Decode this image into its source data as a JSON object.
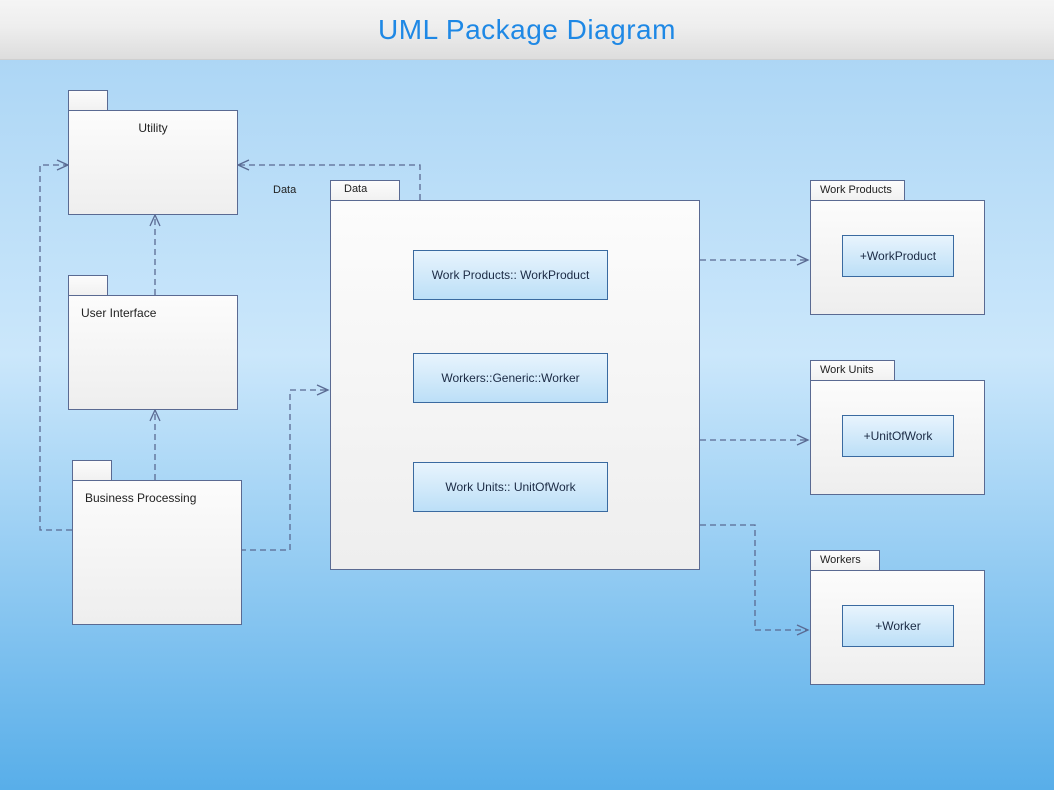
{
  "title": "UML Package Diagram",
  "packages": {
    "utility": {
      "label": "Utility"
    },
    "userInterface": {
      "label": "User Interface"
    },
    "businessProcessing": {
      "label": "Business Processing"
    },
    "data": {
      "label": "Data"
    },
    "workProducts": {
      "label": "Work Products",
      "inner": "+WorkProduct"
    },
    "workUnits": {
      "label": "Work Units",
      "inner": "+UnitOfWork"
    },
    "workers": {
      "label": "Workers",
      "inner": "+Worker"
    }
  },
  "classes": {
    "workProduct": {
      "label": "Work Products:: WorkProduct"
    },
    "worker": {
      "label": "Workers::Generic::Worker"
    },
    "unitOfWork": {
      "label": "Work Units:: UnitOfWork"
    }
  },
  "dependencies": [
    {
      "from": "Business Processing",
      "to": "Utility"
    },
    {
      "from": "User Interface",
      "to": "Utility"
    },
    {
      "from": "Business Processing",
      "to": "User Interface"
    },
    {
      "from": "Data",
      "to": "Utility"
    },
    {
      "from": "Business Processing",
      "to": "Data"
    },
    {
      "from": "Data",
      "to": "Work Products"
    },
    {
      "from": "Data",
      "to": "Work Units"
    },
    {
      "from": "Data",
      "to": "Workers"
    }
  ],
  "associations": [
    {
      "between": [
        "Work Products:: WorkProduct",
        "Workers::Generic::Worker"
      ]
    },
    {
      "between": [
        "Workers::Generic::Worker",
        "Work Units:: UnitOfWork"
      ]
    },
    {
      "between": [
        "Work Products:: WorkProduct",
        "Work Units:: UnitOfWork"
      ],
      "via": [
        "left",
        "right"
      ]
    }
  ]
}
